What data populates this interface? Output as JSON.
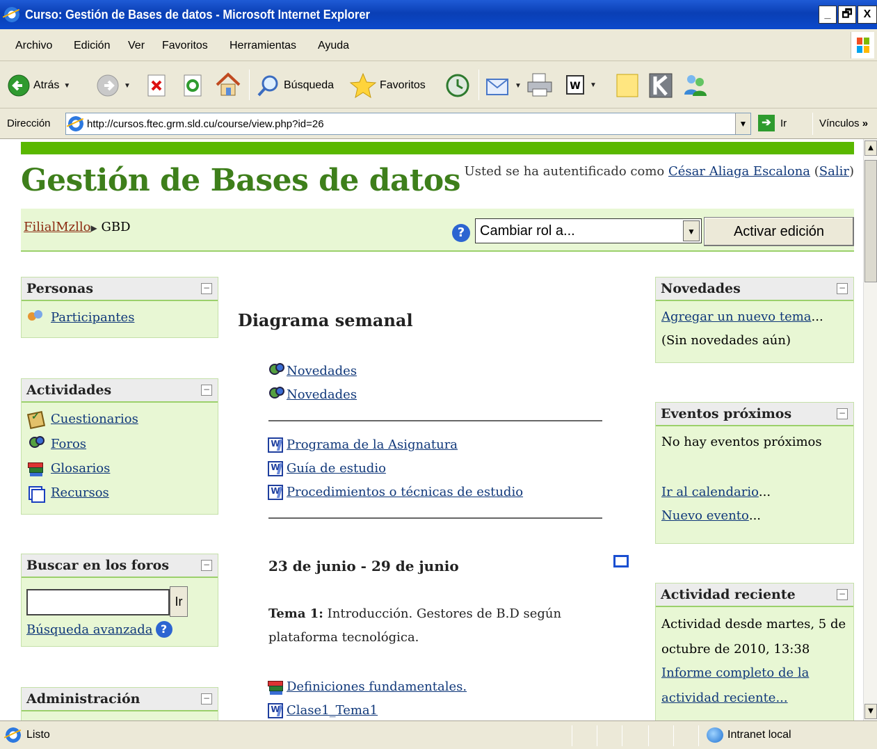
{
  "window": {
    "title": "Curso: Gestión de Bases de datos - Microsoft Internet Explorer",
    "btn_min": "_",
    "btn_max": "🗗",
    "btn_close": "X"
  },
  "menu": [
    "Archivo",
    "Edición",
    "Ver",
    "Favoritos",
    "Herramientas",
    "Ayuda"
  ],
  "toolbar": {
    "back": "Atrás",
    "search": "Búsqueda",
    "favorites": "Favoritos"
  },
  "address": {
    "label": "Dirección",
    "url": "http://cursos.ftec.grm.sld.cu/course/view.php?id=26",
    "go": "Ir",
    "links": "Vínculos",
    "more": "»"
  },
  "page": {
    "site_title": "Gestión de Bases de datos",
    "login_prefix": "Usted se ha autentificado como ",
    "login_user": "César Aliaga Escalona",
    "login_open": " (",
    "logout": "Salir",
    "login_close": ")",
    "breadcrumb_root": "FilialMzllo",
    "breadcrumb_sep": "▶",
    "breadcrumb_current": "GBD",
    "role_select": "Cambiar rol a...",
    "edit_button": "Activar edición"
  },
  "left_blocks": {
    "personas": {
      "title": "Personas",
      "items": [
        "Participantes"
      ]
    },
    "actividades": {
      "title": "Actividades",
      "items": [
        "Cuestionarios",
        "Foros",
        "Glosarios",
        "Recursos"
      ]
    },
    "buscar": {
      "title": "Buscar en los foros",
      "search_value": "",
      "go": "Ir",
      "advanced": "Búsqueda avanzada"
    },
    "admin": {
      "title": "Administración"
    }
  },
  "center": {
    "title": "Diagrama semanal",
    "news": [
      "Novedades",
      "Novedades"
    ],
    "docs": [
      "Programa de la Asignatura",
      "Guía de estudio",
      "Procedimientos o técnicas de estudio"
    ],
    "week_title": "23 de junio - 29 de junio",
    "topic_label": "Tema 1:",
    "topic_text": " Introducción. Gestores de B.D según",
    "topic_text2": "plataforma tecnológica.",
    "week_items": [
      "Definiciones fundamentales.",
      "Clase1_Tema1"
    ]
  },
  "right_blocks": {
    "novedades": {
      "title": "Novedades",
      "link": "Agregar un nuevo tema",
      "ellipsis": "...",
      "empty": "(Sin novedades aún)"
    },
    "eventos": {
      "title": "Eventos próximos",
      "empty": "No hay eventos próximos",
      "calendar": "Ir al calendario",
      "new_event": "Nuevo evento",
      "ellipsis": "..."
    },
    "reciente": {
      "title": "Actividad reciente",
      "line1": "Actividad desde martes, 5 de",
      "line2": "octubre de 2010, 13:38",
      "link1": "Informe completo de la",
      "link2": "actividad reciente..."
    }
  },
  "collapse_glyph": "−",
  "status": {
    "text": "Listo",
    "zone": "Intranet local"
  },
  "colors": {
    "accent_green": "#5ab800",
    "title_green": "#3e7f1b",
    "block_bg": "#e8f7d4",
    "link": "#10387a"
  }
}
